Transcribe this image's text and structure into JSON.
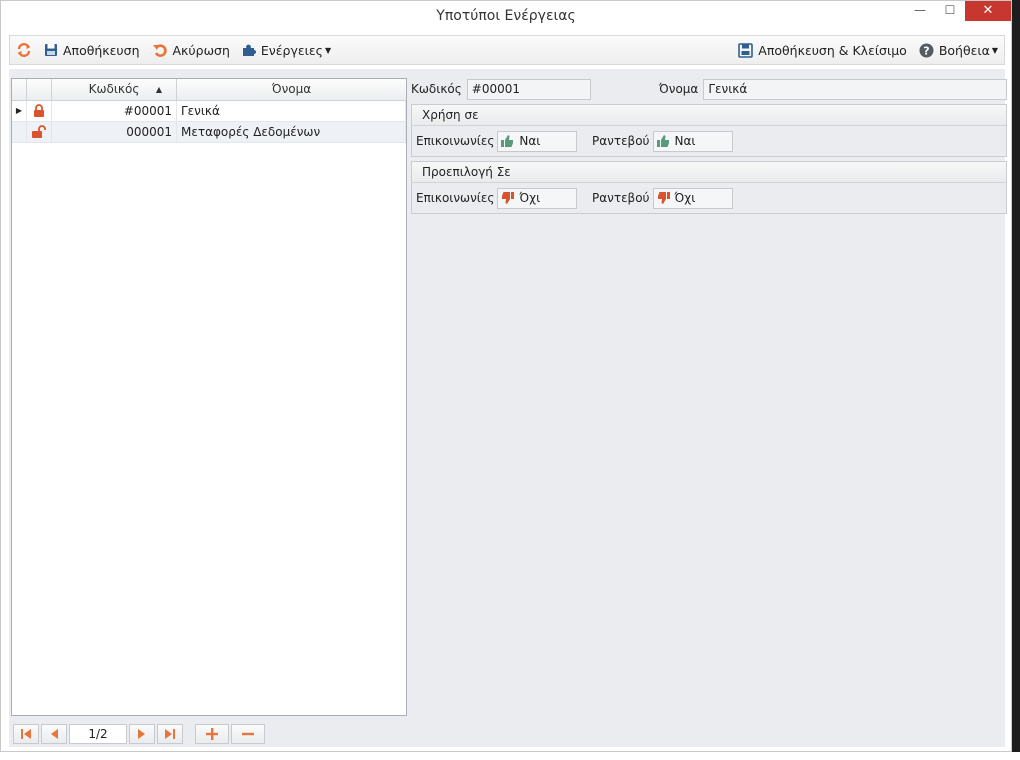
{
  "window": {
    "title": "Υποτύποι Ενέργειας",
    "minimize": "—",
    "maximize": "☐",
    "close": "✕"
  },
  "toolbar": {
    "save_label": "Αποθήκευση",
    "cancel_label": "Ακύρωση",
    "actions_label": "Ενέργειες",
    "save_close_label": "Αποθήκευση & Κλείσιμο",
    "help_label": "Βοήθεια"
  },
  "grid": {
    "columns": {
      "code": "Κωδικός",
      "name": "Όνομα"
    },
    "rows": [
      {
        "code": "#00001",
        "name": "Γενικά",
        "locked": true
      },
      {
        "code": "000001",
        "name": "Μεταφορές Δεδομένων",
        "locked": false
      }
    ],
    "pager": {
      "page": "1/2"
    }
  },
  "form": {
    "code_label": "Κωδικός",
    "code_value": "#00001",
    "name_label": "Όνομα",
    "name_value": "Γενικά",
    "usage": {
      "title": "Χρήση σε",
      "communications_label": "Επικοινωνίες",
      "communications_value": "Ναι",
      "appointments_label": "Ραντεβού",
      "appointments_value": "Ναι"
    },
    "default": {
      "title": "Προεπιλογή Σε",
      "communications_label": "Επικοινωνίες",
      "communications_value": "Όχι",
      "appointments_label": "Ραντεβού",
      "appointments_value": "Όχι"
    }
  },
  "colors": {
    "accent": "#e8743b",
    "brand_blue": "#2f5f8f",
    "yes_green": "#5a9a7a",
    "no_red": "#d9542c"
  }
}
